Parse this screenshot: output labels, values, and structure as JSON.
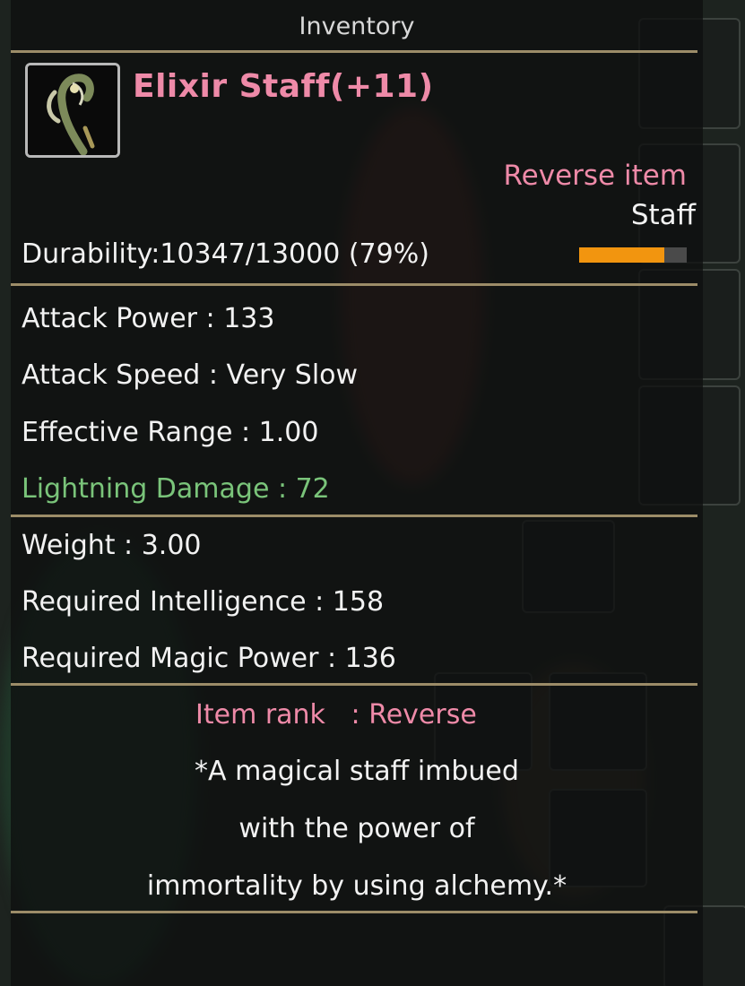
{
  "window": {
    "title": "Inventory"
  },
  "item": {
    "name": "Elixir Staff(+11)",
    "icon": "staff-icon",
    "rarity": "Reverse item",
    "type": "Staff",
    "durability_text": "Durability:10347/13000 (79%)",
    "durability_fraction": 0.79
  },
  "stats": {
    "attack_power": "Attack Power : 133",
    "attack_speed": "Attack Speed : Very Slow",
    "effective_range": "Effective Range : 1.00",
    "lightning_damage": "Lightning Damage : 72"
  },
  "requirements": {
    "weight": "Weight : 3.00",
    "intelligence": "Required Intelligence : 158",
    "magic_power": "Required Magic Power : 136"
  },
  "rank": {
    "label": "Item rank",
    "value": ": Reverse"
  },
  "description": {
    "line1": "*A magical staff imbued",
    "line2": "with the power of",
    "line3": "immortality by using alchemy.*"
  },
  "colors": {
    "rarity_pink": "#ee8aa8",
    "bonus_green": "#7ac47a",
    "durability_orange": "#f2950f",
    "divider_gold": "#9c8c68"
  }
}
